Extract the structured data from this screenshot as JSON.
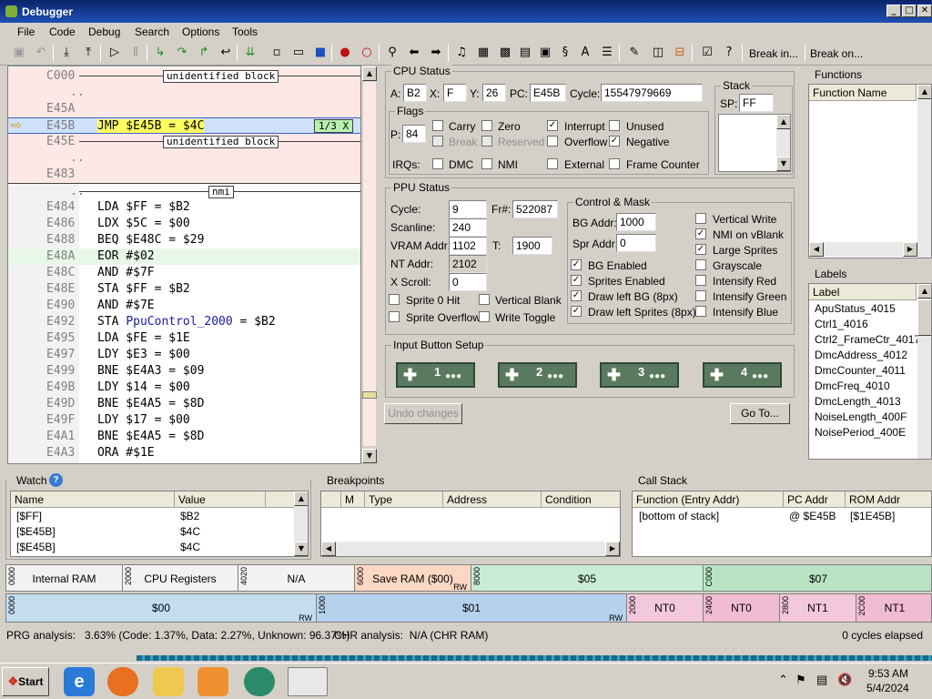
{
  "window": {
    "title": "Debugger"
  },
  "menu": [
    "File",
    "Code",
    "Debug",
    "Search",
    "Options",
    "Tools"
  ],
  "toolbar": {
    "break_in": "Break in...",
    "break_on": "Break on..."
  },
  "code": {
    "lines": [
      {
        "addr": "C000",
        "text": "unidentified block",
        "kind": "block"
      },
      {
        "addr": "..",
        "text": "",
        "kind": "blank"
      },
      {
        "addr": "E45A",
        "text": "",
        "kind": "blank"
      },
      {
        "addr": "E45B",
        "text": "JMP $E45B = $4C",
        "kind": "current",
        "badge": "1/3 X"
      },
      {
        "addr": "E45E",
        "text": "unidentified block",
        "kind": "block"
      },
      {
        "addr": "..",
        "text": "",
        "kind": "blank"
      },
      {
        "addr": "E483",
        "text": "",
        "kind": "blank"
      },
      {
        "addr": "..",
        "text": "nmi",
        "kind": "label"
      },
      {
        "addr": "E484",
        "text": "LDA $FF = $B2",
        "kind": "code"
      },
      {
        "addr": "E486",
        "text": "LDX $5C = $00",
        "kind": "code"
      },
      {
        "addr": "E488",
        "text": "BEQ $E48C = $29",
        "kind": "code"
      },
      {
        "addr": "E48A",
        "text": "EOR #$02",
        "kind": "code"
      },
      {
        "addr": "E48C",
        "text": "AND #$7F",
        "kind": "code"
      },
      {
        "addr": "E48E",
        "text": "STA $FF = $B2",
        "kind": "code"
      },
      {
        "addr": "E490",
        "text": "AND #$7E",
        "kind": "code"
      },
      {
        "addr": "E492",
        "text": "STA PpuControl_2000 = $B2",
        "kind": "code"
      },
      {
        "addr": "E495",
        "text": "LDA $FE = $1E",
        "kind": "code"
      },
      {
        "addr": "E497",
        "text": "LDY $E3 = $00",
        "kind": "code"
      },
      {
        "addr": "E499",
        "text": "BNE $E4A3 = $09",
        "kind": "code"
      },
      {
        "addr": "E49B",
        "text": "LDY $14 = $00",
        "kind": "code"
      },
      {
        "addr": "E49D",
        "text": "BNE $E4A5 = $8D",
        "kind": "code"
      },
      {
        "addr": "E49F",
        "text": "LDY $17 = $00",
        "kind": "code"
      },
      {
        "addr": "E4A1",
        "text": "BNE $E4A5 = $8D",
        "kind": "code"
      },
      {
        "addr": "E4A3",
        "text": "ORA #$1E",
        "kind": "code"
      }
    ]
  },
  "cpu": {
    "title": "CPU Status",
    "a_label": "A:",
    "a": "B2",
    "x_label": "X:",
    "x": "F",
    "y_label": "Y:",
    "y": "26",
    "pc_label": "PC:",
    "pc": "E45B",
    "cycle_label": "Cycle:",
    "cycle": "15547979669",
    "flags_title": "Flags",
    "p_label": "P:",
    "p": "84",
    "flags": {
      "carry": "Carry",
      "zero": "Zero",
      "interrupt": "Interrupt",
      "unused": "Unused",
      "break": "Break",
      "reserved": "Reserved",
      "overflow": "Overflow",
      "negative": "Negative"
    },
    "irqs_label": "IRQs:",
    "irqs": {
      "dmc": "DMC",
      "nmi": "NMI",
      "external": "External",
      "frame_counter": "Frame Counter"
    },
    "stack_title": "Stack",
    "sp_label": "SP:",
    "sp": "FF"
  },
  "ppu": {
    "title": "PPU Status",
    "cycle_label": "Cycle:",
    "cycle": "9",
    "frame_label": "Fr#:",
    "frame": "522087",
    "scanline_label": "Scanline:",
    "scanline": "240",
    "vram_label": "VRAM Addr:",
    "vram": "1102",
    "t_label": "T:",
    "t": "1900",
    "nt_label": "NT Addr:",
    "nt": "2102",
    "xscroll_label": "X Scroll:",
    "xscroll": "0",
    "sprite0": "Sprite 0 Hit",
    "vblank": "Vertical Blank",
    "overflow": "Sprite Overflow",
    "write_toggle": "Write Toggle",
    "control_title": "Control & Mask",
    "bg_addr_label": "BG Addr:",
    "bg_addr": "1000",
    "spr_addr_label": "Spr Addr:",
    "spr_addr": "0",
    "bg_enabled": "BG Enabled",
    "sprites_enabled": "Sprites Enabled",
    "draw_left_bg": "Draw left BG (8px)",
    "draw_left_sprites": "Draw left Sprites (8px)",
    "vertical_write": "Vertical Write",
    "nmi_vblank": "NMI on vBlank",
    "large_sprites": "Large Sprites",
    "grayscale": "Grayscale",
    "int_red": "Intensify Red",
    "int_green": "Intensify Green",
    "int_blue": "Intensify Blue"
  },
  "input": {
    "title": "Input Button Setup",
    "pads": [
      "1",
      "2",
      "3",
      "4"
    ]
  },
  "buttons": {
    "undo": "Undo changes",
    "goto": "Go To..."
  },
  "functions": {
    "title": "Functions",
    "header": "Function Name"
  },
  "labels": {
    "title": "Labels",
    "header": "Label",
    "items": [
      "ApuStatus_4015",
      "Ctrl1_4016",
      "Ctrl2_FrameCtr_4017",
      "DmcAddress_4012",
      "DmcCounter_4011",
      "DmcFreq_4010",
      "DmcLength_4013",
      "NoiseLength_400F",
      "NoisePeriod_400E"
    ]
  },
  "watch": {
    "title": "Watch",
    "col_name": "Name",
    "col_value": "Value",
    "rows": [
      {
        "name": "[$FF]",
        "value": "$B2"
      },
      {
        "name": "[$E45B]",
        "value": "$4C"
      },
      {
        "name": "[$E45B]",
        "value": "$4C"
      }
    ]
  },
  "breakpoints": {
    "title": "Breakpoints",
    "cols": [
      "M",
      "Type",
      "Address",
      "Condition"
    ]
  },
  "callstack": {
    "title": "Call Stack",
    "cols": [
      "Function (Entry Addr)",
      "PC Addr",
      "ROM Addr"
    ],
    "rows": [
      {
        "func": "[bottom of stack]",
        "pc": "@ $E45B",
        "rom": "[$1E45B]"
      }
    ]
  },
  "memmap": {
    "row1": [
      {
        "addr": "0000",
        "label": "Internal RAM",
        "rw": ""
      },
      {
        "addr": "2000",
        "label": "CPU Registers",
        "rw": ""
      },
      {
        "addr": "4020",
        "label": "N/A",
        "rw": ""
      },
      {
        "addr": "6000",
        "label": "Save RAM ($00)",
        "rw": "RW"
      },
      {
        "addr": "8000",
        "label": "$05",
        "rw": ""
      },
      {
        "addr": "C000",
        "label": "$07",
        "rw": ""
      }
    ],
    "row2": [
      {
        "addr": "0000",
        "label": "$00",
        "rw": "RW"
      },
      {
        "addr": "1000",
        "label": "$01",
        "rw": "RW"
      },
      {
        "addr": "2000",
        "label": "NT0",
        "rw": ""
      },
      {
        "addr": "2400",
        "label": "NT0",
        "rw": ""
      },
      {
        "addr": "2800",
        "label": "NT1",
        "rw": ""
      },
      {
        "addr": "2C00",
        "label": "NT1",
        "rw": ""
      }
    ]
  },
  "status": {
    "prg": "PRG analysis:   3.63% (Code: 1.37%, Data: 2.27%, Unknown: 96.37%)",
    "chr": "CHR analysis:  N/A (CHR RAM)",
    "cycles": "0 cycles elapsed"
  },
  "taskbar": {
    "start": "Start",
    "time": "9:53 AM",
    "date": "5/4/2024"
  },
  "colors": {
    "titlebar": "#0a246a",
    "current_line": "#cfe0fb",
    "highlight": "#ffff60",
    "block": "#fde8e5",
    "label_addr": "#1a1aa0"
  }
}
